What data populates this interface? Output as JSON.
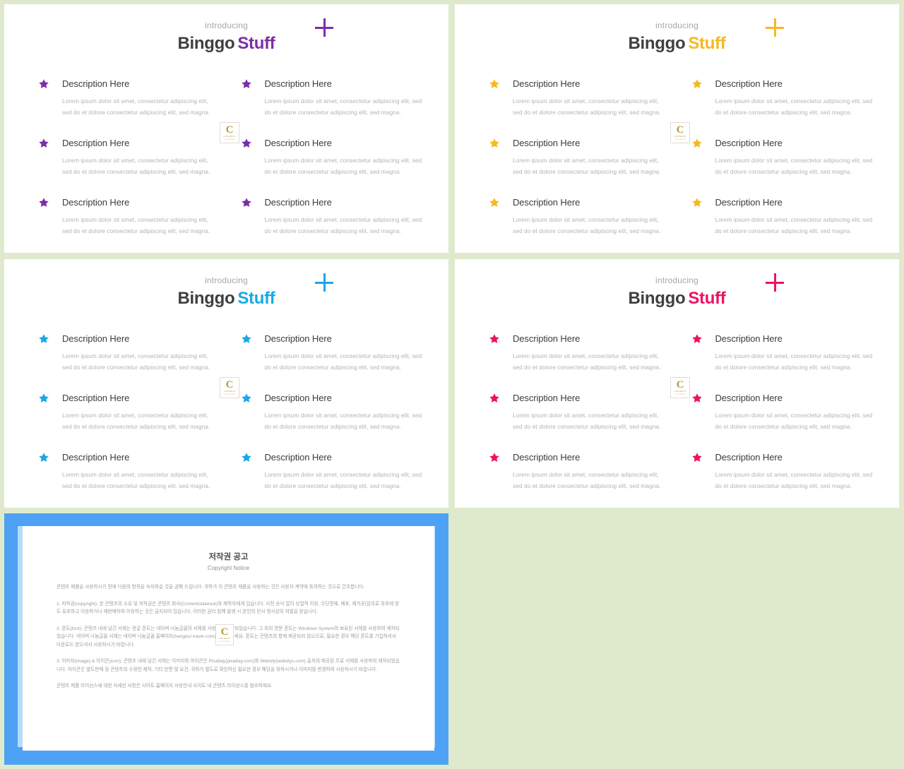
{
  "page": {
    "background_color": "#dfeacd"
  },
  "slides": [
    {
      "id": "slide-purple",
      "accent_color": "#7a2ea8",
      "header": {
        "eyebrow": "introducing",
        "brand_primary": "Binggo",
        "brand_accent": "Stuff"
      },
      "plus_icon": "plus-icon",
      "items": [
        {
          "title": "Description Here",
          "body": "Lorem ipsum dolor sit amet, consectetur adipiscing elit, sed do et dolore consectetur adipiscing elit, sed magna."
        },
        {
          "title": "Description Here",
          "body": "Lorem ipsum dolor sit amet, consectetur adipiscing elit, sed do et dolore consectetur adipiscing elit, sed magna."
        },
        {
          "title": "Description Here",
          "body": "Lorem ipsum dolor sit amet, consectetur adipiscing elit, sed do et dolore consectetur adipiscing elit, sed magna."
        },
        {
          "title": "Description Here",
          "body": "Lorem ipsum dolor sit amet, consectetur adipiscing elit, sed do et dolore consectetur adipiscing elit, sed magna."
        },
        {
          "title": "Description Here",
          "body": "Lorem ipsum dolor sit amet, consectetur adipiscing elit, sed do et dolore consectetur adipiscing elit, sed magna."
        },
        {
          "title": "Description Here",
          "body": "Lorem ipsum dolor sit amet, consectetur adipiscing elit, sed do et dolore consectetur adipiscing elit, sed magna."
        }
      ]
    },
    {
      "id": "slide-yellow",
      "accent_color": "#f5b921",
      "header": {
        "eyebrow": "introducing",
        "brand_primary": "Binggo",
        "brand_accent": "Stuff"
      },
      "plus_icon": "plus-icon",
      "items": [
        {
          "title": "Description Here",
          "body": "Lorem ipsum dolor sit amet, consectetur adipiscing elit, sed do et dolore consectetur adipiscing elit, sed magna."
        },
        {
          "title": "Description Here",
          "body": "Lorem ipsum dolor sit amet, consectetur adipiscing elit, sed do et dolore consectetur adipiscing elit, sed magna."
        },
        {
          "title": "Description Here",
          "body": "Lorem ipsum dolor sit amet, consectetur adipiscing elit, sed do et dolore consectetur adipiscing elit, sed magna."
        },
        {
          "title": "Description Here",
          "body": "Lorem ipsum dolor sit amet, consectetur adipiscing elit, sed do et dolore consectetur adipiscing elit, sed magna."
        },
        {
          "title": "Description Here",
          "body": "Lorem ipsum dolor sit amet, consectetur adipiscing elit, sed do et dolore consectetur adipiscing elit, sed magna."
        },
        {
          "title": "Description Here",
          "body": "Lorem ipsum dolor sit amet, consectetur adipiscing elit, sed do et dolore consectetur adipiscing elit, sed magna."
        }
      ]
    },
    {
      "id": "slide-blue",
      "accent_color": "#19a8e8",
      "header": {
        "eyebrow": "introducing",
        "brand_primary": "Binggo",
        "brand_accent": "Stuff"
      },
      "plus_icon": "plus-icon",
      "items": [
        {
          "title": "Description Here",
          "body": "Lorem ipsum dolor sit amet, consectetur adipiscing elit, sed do et dolore consectetur adipiscing elit, sed magna."
        },
        {
          "title": "Description Here",
          "body": "Lorem ipsum dolor sit amet, consectetur adipiscing elit, sed do et dolore consectetur adipiscing elit, sed magna."
        },
        {
          "title": "Description Here",
          "body": "Lorem ipsum dolor sit amet, consectetur adipiscing elit, sed do et dolore consectetur adipiscing elit, sed magna."
        },
        {
          "title": "Description Here",
          "body": "Lorem ipsum dolor sit amet, consectetur adipiscing elit, sed do et dolore consectetur adipiscing elit, sed magna."
        },
        {
          "title": "Description Here",
          "body": "Lorem ipsum dolor sit amet, consectetur adipiscing elit, sed do et dolore consectetur adipiscing elit, sed magna."
        },
        {
          "title": "Description Here",
          "body": "Lorem ipsum dolor sit amet, consectetur adipiscing elit, sed do et dolore consectetur adipiscing elit, sed magna."
        }
      ]
    },
    {
      "id": "slide-pink",
      "accent_color": "#ed1164",
      "header": {
        "eyebrow": "introducing",
        "brand_primary": "Binggo",
        "brand_accent": "Stuff"
      },
      "plus_icon": "plus-icon",
      "items": [
        {
          "title": "Description Here",
          "body": "Lorem ipsum dolor sit amet, consectetur adipiscing elit, sed do et dolore consectetur adipiscing elit, sed magna."
        },
        {
          "title": "Description Here",
          "body": "Lorem ipsum dolor sit amet, consectetur adipiscing elit, sed do et dolore consectetur adipiscing elit, sed magna."
        },
        {
          "title": "Description Here",
          "body": "Lorem ipsum dolor sit amet, consectetur adipiscing elit, sed do et dolore consectetur adipiscing elit, sed magna."
        },
        {
          "title": "Description Here",
          "body": "Lorem ipsum dolor sit amet, consectetur adipiscing elit, sed do et dolore consectetur adipiscing elit, sed magna."
        },
        {
          "title": "Description Here",
          "body": "Lorem ipsum dolor sit amet, consectetur adipiscing elit, sed do et dolore consectetur adipiscing elit, sed magna."
        },
        {
          "title": "Description Here",
          "body": "Lorem ipsum dolor sit amet, consectetur adipiscing elit, sed do et dolore consectetur adipiscing elit, sed magna."
        }
      ]
    }
  ],
  "watermark_logo": {
    "letter": "C",
    "line1": "CONTENTS",
    "line2": "PPT   DESIGN"
  },
  "copyright_panel": {
    "frame_color": "#4da2f5",
    "frame_inner_color": "#b6dcfb",
    "title": "저작권 공고",
    "subtitle": "Copyright Notice",
    "intro": "콘텐츠 제품을 사용하시기 전에 다음의 항목을 숙지하실 것을 권해 드립니다. 귀하가 이 콘텐츠 제품을 사용하는 것은 사용자 계약에 동의하는 것으로 간주합니다.",
    "sections": [
      {
        "heading": "1. 저작권(copyright):",
        "body": "본 콘텐츠의 소유 및 저작권은 콘텐츠 회사(Contentstakeout)와 제작자에게 있습니다. 사전 승낙 없이 상업적 이용, 무단전재, 배포, 재가공(임의로 외부에 양도 유포하고 이용하거나 재판매하여 이용하는 것은 금지되어 있습니다. 이러한 권리 침해 발생 시 본인의 민사 형사상의 처벌을 받습니다."
      },
      {
        "heading": "2. 폰트(font):",
        "body": "콘텐츠 내에 담긴 서체는 한글 폰트는 네이버 나눔글꼴의 서체를 사용하여 제작되었습니다. 그 외의 영문 폰트는 Windows System의 보유된 서체를 사용하여 제작되었습니다. 네이버 나눔글꼴 서체는 네이버 나눔글꼴 홈페이지(hangeul.naver.com)를 참조하세요. 폰트는 콘텐츠의 함께 제공되지 않으므로, 필요한 경우 해당 폰트를 기입하셔서 다운로드 받으셔서 사용하시기 바랍니다."
      },
      {
        "heading": "3. 이미지(image) & 아이콘(icon):",
        "body": "콘텐츠 내에 담긴 서체는 이미지와 아이콘은 Pixabay(pixabay.com)와 Weboly(webolys.com) 출처의 제공된 무료 서체를 사용하여 제작되었습니다. 아이콘은 별도판매 및 콘텐츠의 수정한 제작, 기타 한편 및 요건, 귀하가 별도로 확인하신 필요한 경우 해당을 위하시거나 이미지를 변경하여 사용하시기 바랍니다."
      }
    ],
    "footer": "콘텐츠 제품 라이선스에 대한 자세한 사항은 사이트 홈페이지 사용안내 사이트 내 콘텐츠 라이선스를 참조하세요."
  }
}
